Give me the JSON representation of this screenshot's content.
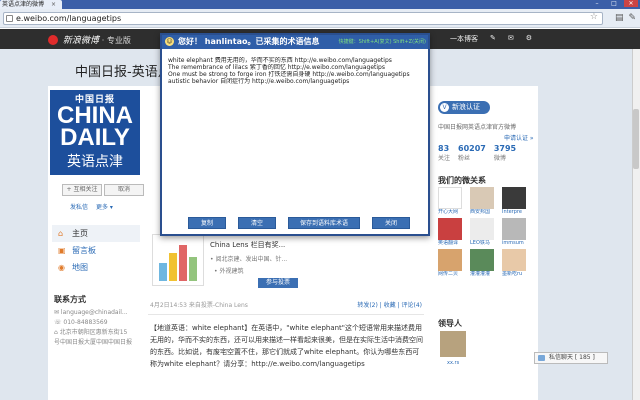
{
  "browser": {
    "tab_title": "英语点津的微博",
    "url": "e.weibo.com/languagetips",
    "controls": {
      "minimize": "–",
      "maximize": "□",
      "close": "✕"
    }
  },
  "weibo_bar": {
    "logo_text": "新浪微博",
    "logo_sub": "· 专业版",
    "right_items": [
      "一本博客",
      "✎",
      "✉",
      "⚙"
    ]
  },
  "page": {
    "title": "中国日报-英语点"
  },
  "logo": {
    "cn": "中国日报",
    "en_line1": "CHINA",
    "en_line2": "DAILY",
    "sub": "英语点津"
  },
  "profile": {
    "follow_label": "+ 互相关注",
    "cancel_label": "取消",
    "message_label": "发私信",
    "more_label": "更多 ▾"
  },
  "nav": {
    "items": [
      {
        "label": "主页",
        "icon": "⌂"
      },
      {
        "label": "留言板",
        "icon": "▣"
      },
      {
        "label": "地图",
        "icon": "◉"
      }
    ]
  },
  "contact": {
    "title": "联系方式",
    "lines": [
      "✉ language@chinadail...",
      "☏ 010-84883569",
      "⌂ 北京市朝阳区惠新东街15",
      "号中国日报大厦中国中国日报"
    ]
  },
  "feed": {
    "lens_title": "China Lens 栏目有奖...",
    "lens_sub": "• 阅北京建、发出中国、针...",
    "lens_sub2": "• 外视建筑",
    "reply_label": "参与投票",
    "meta_left": "4月2日14:53  来自投票-China Lens",
    "actions": "转发(2) | 收藏 | 评论(4)",
    "text": "【地道英语：white elephant】在英语中，\"white elephant\"这个短语常用来描述费用无用的，华而不实的东西，还可以用来描述一样看起来很美，但是在实际生活中消费空间的东西。比如说，有废宅空置不住，那它们就成了white elephant。你认为哪些东西可称为white elephant？请分享：http://e.weibo.com/languagetips"
  },
  "right": {
    "verified_label": "新浪认证",
    "verified_desc": "中国日报网英语点津官方微博",
    "apply_label": "申请认证 »",
    "stats": [
      {
        "num": "83",
        "label": "关注"
      },
      {
        "num": "60207",
        "label": "粉丝"
      },
      {
        "num": "3795",
        "label": "微博"
      }
    ],
    "relations_title": "我们的微关系",
    "relations": [
      "开心大网",
      "西安邦国",
      "Interpre",
      "英语翻译",
      "LEO铁马",
      "immsum",
      "网传二贝",
      "灌灌灌灌",
      "墨新吃ru"
    ],
    "leader_title": "领导人",
    "leader_name": "xx.rs"
  },
  "chat": {
    "label": "私信聊天 [ 185 ]"
  },
  "popup": {
    "greeting": "您好！ hanlintao。已采集的术语信息",
    "shortcut": "快捷键：Shift+A(复文) Shift+Z(关闭)",
    "lines": [
      "white elephant   费用无用的，华而不实的东西   http://e.weibo.com/languagetips",
      "The remembrance of lilacs   紫丁香的回忆   http://e.weibo.com/languagetips",
      "One must be strong to forge iron   打铁还需自身硬   http://e.weibo.com/languagetips",
      "autistic behavior   自闭症行为   http://e.weibo.com/languagetips"
    ],
    "buttons": {
      "copy": "复制",
      "clear": "清空",
      "save": "保存到语料库术语",
      "close": "关闭"
    }
  },
  "colors": {
    "accent": "#3b6fb3",
    "popup_header": "#2f5ea8",
    "weibo_bar": "#2e2e2e",
    "logo_blue": "#1d4f9c"
  }
}
